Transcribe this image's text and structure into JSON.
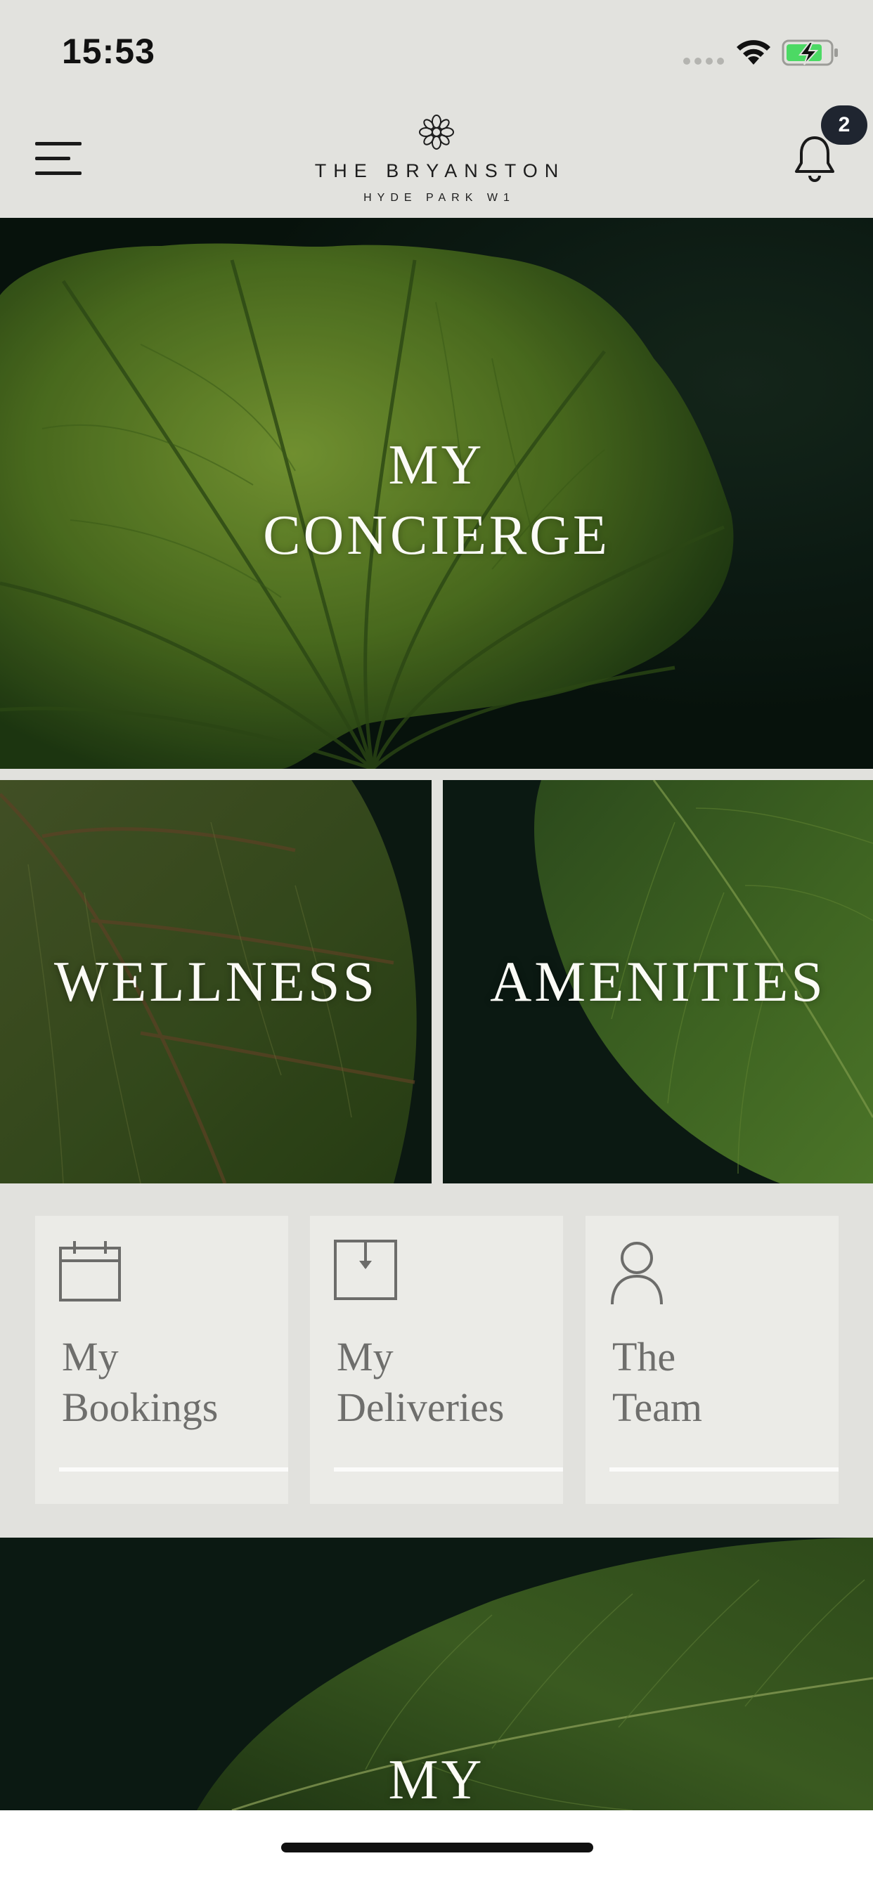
{
  "status_bar": {
    "time": "15:53"
  },
  "header": {
    "brand_title": "THE BRYANSTON",
    "brand_subtitle": "HYDE PARK W1",
    "notification_count": "2"
  },
  "tiles": {
    "concierge": {
      "line1": "MY",
      "line2": "CONCIERGE"
    },
    "wellness": "WELLNESS",
    "amenities": "AMENITIES",
    "bottom_partial": "MY"
  },
  "quick_links": [
    {
      "line1": "My",
      "line2": "Bookings",
      "icon": "calendar-icon"
    },
    {
      "line1": "My",
      "line2": "Deliveries",
      "icon": "inbox-download-icon"
    },
    {
      "line1": "The",
      "line2": "Team",
      "icon": "person-icon"
    }
  ],
  "colors": {
    "background": "#e1e1dd",
    "card": "#ebebe7",
    "card_text": "#6e6e6c",
    "leaf_dark": "#0c1b13",
    "leaf_green": "#5f8427",
    "badge": "#1f2530"
  }
}
